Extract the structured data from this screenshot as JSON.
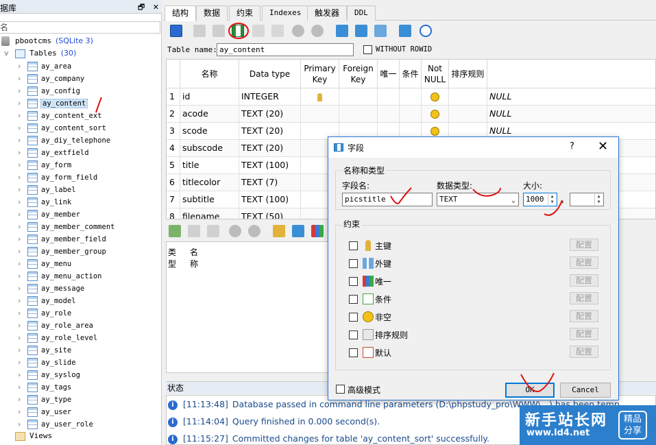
{
  "left_panel": {
    "title": "据库",
    "title_buttons": [
      "🗗",
      "✕"
    ],
    "filter_placeholder": "名",
    "db_name": "pbootcms",
    "db_type": "(SQLite 3)",
    "tables_label": "Tables",
    "tables_count": "(30)",
    "selected_table": "ay_content",
    "tables": [
      "ay_area",
      "ay_company",
      "ay_config",
      "ay_content",
      "ay_content_ext",
      "ay_content_sort",
      "ay_diy_telephone",
      "ay_extfield",
      "ay_form",
      "ay_form_field",
      "ay_label",
      "ay_link",
      "ay_member",
      "ay_member_comment",
      "ay_member_field",
      "ay_member_group",
      "ay_menu",
      "ay_menu_action",
      "ay_message",
      "ay_model",
      "ay_role",
      "ay_role_area",
      "ay_role_level",
      "ay_site",
      "ay_slide",
      "ay_syslog",
      "ay_tags",
      "ay_type",
      "ay_user",
      "ay_user_role"
    ],
    "views_label": "Views"
  },
  "tabs": [
    "结构",
    "数据",
    "约束",
    "Indexes",
    "触发器",
    "DDL"
  ],
  "active_tab": "结构",
  "table_name_label": "Table name:",
  "table_name_value": "ay_content",
  "without_rowid_label": "WITHOUT ROWID",
  "grid": {
    "headers": [
      "名称",
      "Data type",
      "Primary\nKey",
      "Foreign\nKey",
      "唯一",
      "条件",
      "Not\nNULL",
      "排序规则"
    ],
    "rows": [
      {
        "n": "1",
        "name": "id",
        "type": "INTEGER",
        "pk": true,
        "nn": true,
        "def": "NULL"
      },
      {
        "n": "2",
        "name": "acode",
        "type": "TEXT (20)",
        "pk": false,
        "nn": true,
        "def": "NULL"
      },
      {
        "n": "3",
        "name": "scode",
        "type": "TEXT (20)",
        "pk": false,
        "nn": true,
        "def": "NULL"
      },
      {
        "n": "4",
        "name": "subscode",
        "type": "TEXT (20)",
        "pk": false,
        "nn": false,
        "def": ""
      },
      {
        "n": "5",
        "name": "title",
        "type": "TEXT (100)",
        "pk": false,
        "nn": false,
        "def": ""
      },
      {
        "n": "6",
        "name": "titlecolor",
        "type": "TEXT (7)",
        "pk": false,
        "nn": false,
        "def": ""
      },
      {
        "n": "7",
        "name": "subtitle",
        "type": "TEXT (100)",
        "pk": false,
        "nn": false,
        "def": ""
      },
      {
        "n": "8",
        "name": "filename",
        "type": "TEXT (50)",
        "pk": false,
        "nn": false,
        "def": ""
      }
    ]
  },
  "lower_grid": {
    "headers": [
      "类型",
      "名称"
    ]
  },
  "status": {
    "title": "状态",
    "log": [
      {
        "time": "[11:13:48]",
        "text": "Database passed in command line parameters (D:\\phpstudy_pro\\WWW\\...) has been temp"
      },
      {
        "time": "[11:14:04]",
        "text": "Query finished in 0.000 second(s)."
      },
      {
        "time": "[11:15:27]",
        "text": "Committed changes for table 'ay_content_sort' successfully."
      }
    ]
  },
  "dialog": {
    "title": "字段",
    "help": "?",
    "close": "✕",
    "group_name_type": "名称和类型",
    "field_name_label": "字段名:",
    "field_name_value": "picstitle",
    "data_type_label": "数据类型:",
    "data_type_value": "TEXT",
    "size_label": "大小:",
    "size_value": "1000",
    "size_sep": ",",
    "scale_value": "",
    "group_constraints": "约束",
    "constraints": [
      {
        "label": "主键",
        "icon": "key-icon"
      },
      {
        "label": "外键",
        "icon": "foreign-key-icon"
      },
      {
        "label": "唯一",
        "icon": "unique-icon"
      },
      {
        "label": "条件",
        "icon": "check-icon"
      },
      {
        "label": "非空",
        "icon": "not-null-icon"
      },
      {
        "label": "排序规则",
        "icon": "collation-icon"
      },
      {
        "label": "默认",
        "icon": "default-icon"
      }
    ],
    "configure_label": "配置",
    "advanced_label": "高级模式",
    "ok_label": "OK",
    "cancel_label": "Cancel"
  },
  "watermark": {
    "line1": "新手站长网",
    "line2": "www.ld4.net",
    "badge": "精品\n分享"
  }
}
